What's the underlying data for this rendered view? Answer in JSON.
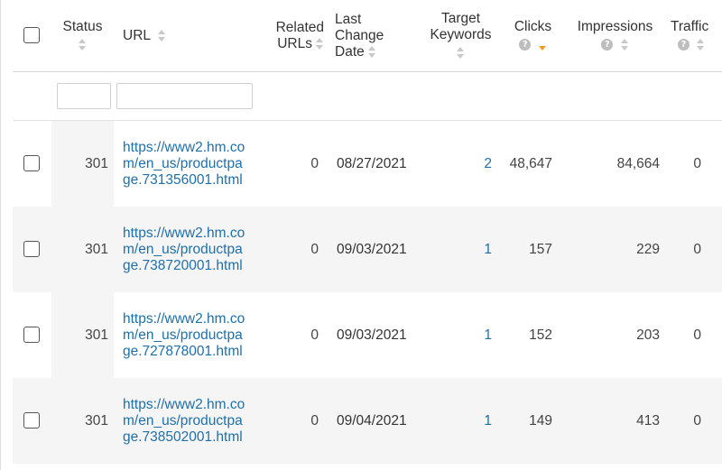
{
  "columns": {
    "status": "Status",
    "url": "URL",
    "related_urls_1": "Related",
    "related_urls_2": "URLs",
    "last_change_1": "Last",
    "last_change_2": "Change",
    "last_change_3": "Date",
    "target_keywords_1": "Target",
    "target_keywords_2": "Keywords",
    "clicks": "Clicks",
    "impressions": "Impressions",
    "traffic": "Traffic",
    "help_glyph": "?"
  },
  "rows": [
    {
      "status": "301",
      "url": "https://www2.hm.com/en_us/productpage.731356001.html",
      "related": "0",
      "date": "08/27/2021",
      "keywords": "2",
      "clicks": "48,647",
      "impressions": "84,664",
      "traffic": "0"
    },
    {
      "status": "301",
      "url": "https://www2.hm.com/en_us/productpage.738720001.html",
      "related": "0",
      "date": "09/03/2021",
      "keywords": "1",
      "clicks": "157",
      "impressions": "229",
      "traffic": "0"
    },
    {
      "status": "301",
      "url": "https://www2.hm.com/en_us/productpage.727878001.html",
      "related": "0",
      "date": "09/03/2021",
      "keywords": "1",
      "clicks": "152",
      "impressions": "203",
      "traffic": "0"
    },
    {
      "status": "301",
      "url": "https://www2.hm.com/en_us/productpage.738502001.html",
      "related": "0",
      "date": "09/04/2021",
      "keywords": "1",
      "clicks": "149",
      "impressions": "413",
      "traffic": "0"
    }
  ],
  "colors": {
    "link": "#1f6fa8",
    "sort_active": "#f29d25"
  },
  "sort": {
    "column": "clicks",
    "direction": "descending"
  }
}
